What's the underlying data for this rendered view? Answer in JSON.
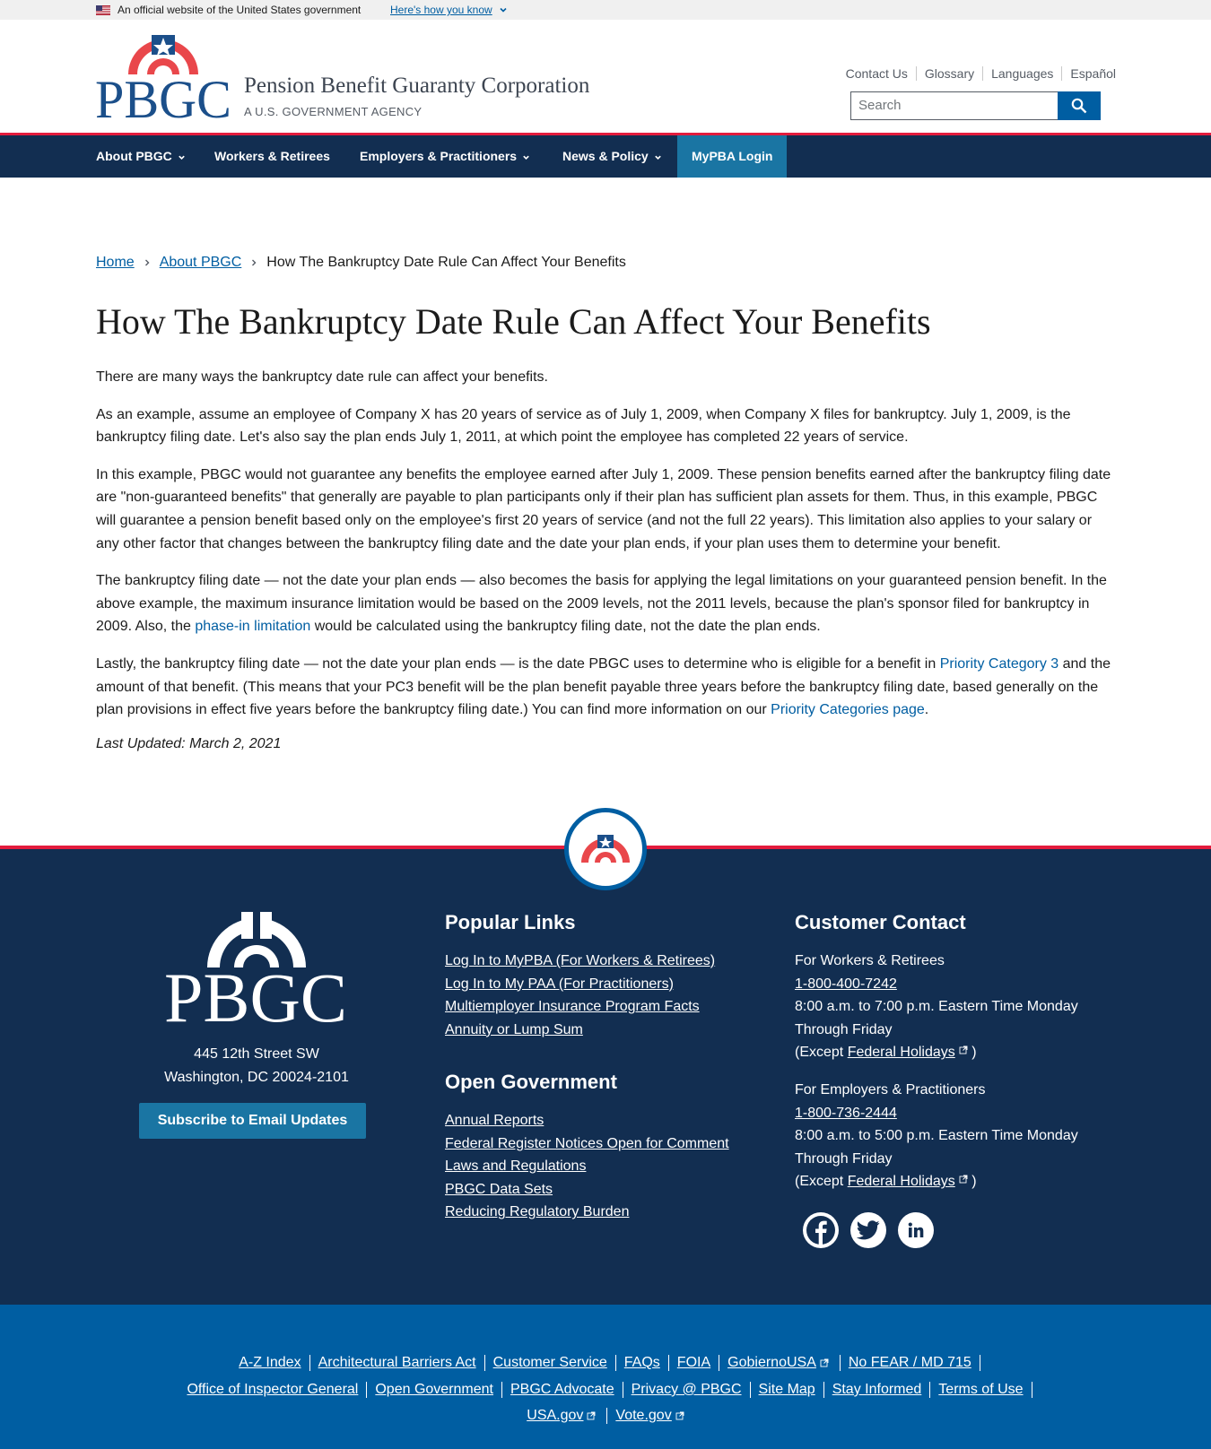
{
  "gov_banner": {
    "text": "An official website of the United States government",
    "link": "Here's how you know"
  },
  "header": {
    "agency_name": "Pension Benefit Guaranty Corporation",
    "agency_sub": "A U.S. GOVERNMENT AGENCY",
    "logo_text": "PBGC",
    "util_links": [
      "Contact Us",
      "Glossary",
      "Languages",
      "Español"
    ],
    "search_placeholder": "Search"
  },
  "nav": {
    "items": [
      {
        "label": "About PBGC",
        "dropdown": true
      },
      {
        "label": "Workers & Retirees",
        "dropdown": false
      },
      {
        "label": "Employers & Practitioners",
        "dropdown": true
      },
      {
        "label": "News & Policy",
        "dropdown": true
      }
    ],
    "login": "MyPBA Login"
  },
  "breadcrumb": {
    "home": "Home",
    "parent": "About PBGC",
    "current": "How The Bankruptcy Date Rule Can Affect Your Benefits"
  },
  "page": {
    "title": "How The Bankruptcy Date Rule Can Affect Your Benefits",
    "p1": "There are many ways the bankruptcy date rule can affect your benefits.",
    "p2": "As an example, assume an employee of Company X has 20 years of service as of July 1, 2009, when Company X files for bankruptcy. July 1, 2009, is the bankruptcy filing date. Let's also say the plan ends July 1, 2011, at which point the employee has completed 22 years of service.",
    "p3": "In this example, PBGC would not guarantee any benefits the employee earned after July 1, 2009. These pension benefits earned after the bankruptcy filing date are \"non-guaranteed benefits\" that generally are payable to plan participants only if their plan has sufficient plan assets for them. Thus, in this example, PBGC will guarantee a pension benefit based only on the employee's first 20 years of service (and not the full 22 years). This limitation also applies to your salary or any other factor that changes between the bankruptcy filing date and the date your plan ends, if your plan uses them to determine your benefit.",
    "p4_a": "The bankruptcy filing date — not the date your plan ends — also becomes the basis for applying the legal limitations on your guaranteed pension benefit. In the above example, the maximum insurance limitation would be based on the 2009 levels, not the 2011 levels, because the plan's sponsor filed for bankruptcy in 2009. Also, the ",
    "p4_link": "phase-in limitation",
    "p4_b": " would be calculated using the bankruptcy filing date, not the date the plan ends.",
    "p5_a": "Lastly, the bankruptcy filing date — not the date your plan ends — is the date PBGC uses to determine who is eligible for a benefit in ",
    "p5_link1": "Priority Category 3",
    "p5_b": " and the amount of that benefit. (This means that your PC3 benefit will be the plan benefit payable three years before the bankruptcy filing date, based generally on the plan provisions in effect five years before the bankruptcy filing date.)  You can find more information on our ",
    "p5_link2": "Priority Categories page",
    "p5_c": ".",
    "updated": "Last Updated: March 2, 2021"
  },
  "footer": {
    "logo_text": "PBGC",
    "address1": "445 12th Street SW",
    "address2": "Washington, DC 20024-2101",
    "subscribe": "Subscribe to Email Updates",
    "popular_title": "Popular Links",
    "popular": [
      "Log In to MyPBA (For Workers & Retirees)",
      "Log In to My PAA (For Practitioners)",
      "Multiemployer Insurance Program Facts",
      "Annuity or Lump Sum"
    ],
    "open_title": "Open Government",
    "open": [
      "Annual Reports",
      "Federal Register Notices Open for Comment",
      "Laws and Regulations",
      "PBGC Data Sets",
      "Reducing Regulatory Burden"
    ],
    "contact_title": "Customer Contact",
    "workers_label": "For Workers & Retirees",
    "workers_phone": "1-800-400-7242",
    "workers_hours": "8:00 a.m. to 7:00 p.m. Eastern Time Monday Through Friday",
    "except_open": "(Except ",
    "holidays": "Federal Holidays",
    "except_close": " )",
    "employers_label": "For Employers & Practitioners",
    "employers_phone": "1-800-736-2444",
    "employers_hours": "8:00 a.m. to 5:00 p.m. Eastern Time Monday Through Friday",
    "social_icons": [
      "facebook-icon",
      "twitter-icon",
      "linkedin-icon"
    ]
  },
  "bottom_links": {
    "row1": [
      "A-Z Index",
      "Architectural Barriers Act",
      "Customer Service",
      "FAQs",
      "FOIA",
      "GobiernoUSA",
      "No FEAR / MD 715"
    ],
    "row2": [
      "Office of Inspector General",
      "Open Government",
      "PBGC Advocate",
      "Privacy @ PBGC",
      "Site Map",
      "Stay Informed",
      "Terms of Use"
    ],
    "row3": [
      "USA.gov",
      "Vote.gov"
    ]
  },
  "colors": {
    "navy": "#122e51",
    "red": "#e31c3d",
    "blue": "#005ea2",
    "teal": "#1a75a3"
  }
}
